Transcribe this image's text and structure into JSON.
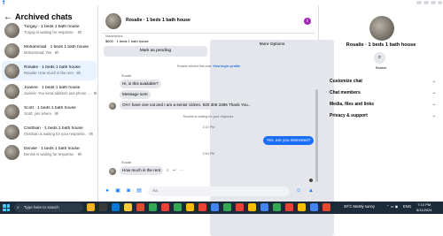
{
  "sidebar": {
    "title": "Archived chats",
    "chats": [
      {
        "name": "Turgay · 1 beds 1 bath house",
        "snippet": "Turgay is waiting for response. · 8h"
      },
      {
        "name": "Mohammad · 1 beds 1 bath house",
        "snippet": "Mohammad: Yes · 8h"
      },
      {
        "name": "Rosalie · 1 beds 1 bath house",
        "snippet": "Rosalie: How much is the rent · 8h"
      },
      {
        "name": "Joanne · 1 beds 1 bath house",
        "snippet": "Joanne: You send address and phone ... · 8h"
      },
      {
        "name": "Scott · 1 beds 1 bath house",
        "snippet": "Scott: yes where · 8h"
      },
      {
        "name": "Cristhian · 1 beds 1 bath house",
        "snippet": "Cristhian is waiting for your response. · 9h"
      },
      {
        "name": "Denise · 1 beds 1 bath house",
        "snippet": "Denise is waiting for response. · 9h"
      }
    ]
  },
  "conversation": {
    "title": "Rosalie · 1 beds 1 bath house",
    "marketplace_label": "Marketplace",
    "marketplace_item": "$600 · 1 beds 1 bath house",
    "mark_pending": "Mark as pending",
    "more_options": "More Options",
    "started_note": "Rosalie started this chat.",
    "view_profile": "View buyer profile",
    "sender_name": "Rosalie",
    "messages": [
      "Hi, is this available?",
      "Message sent",
      "OH I have one cat and I am a senior citizen. 920 306 3395  Thank You.."
    ],
    "waiting_note": "Rosalie is waiting for your response.",
    "time_1": "2:24 PM",
    "outgoing": "Yes, are you interested?",
    "time_2": "2:54 PM",
    "sender_name_2": "Rosalie",
    "last_message": "How much is the rent",
    "composer_placeholder": "Aa"
  },
  "right_panel": {
    "name": "Rosalie · 1 beds 1 bath house",
    "search_label": "Search",
    "rows": [
      "Customize chat",
      "Chat members",
      "Media, files and links",
      "Privacy & support"
    ]
  },
  "taskbar": {
    "search_placeholder": "Type here to search",
    "weather": "39°C  Mostly sunny",
    "lang": "ENG",
    "time": "7:10 PM",
    "date": "8/11/2024"
  },
  "colors": {
    "accent": "#1877f2",
    "outgoing_bubble": "#1a6ef5",
    "taskbar": "#1c2b3a"
  }
}
